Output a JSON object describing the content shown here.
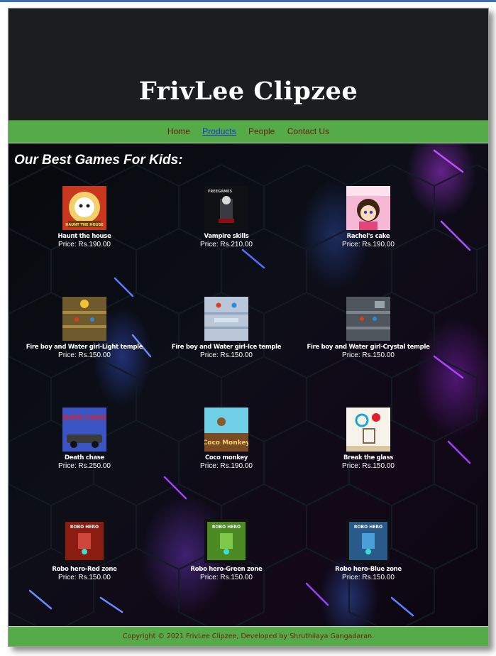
{
  "site": {
    "title": "FrivLee Clipzee"
  },
  "nav": {
    "items": [
      {
        "label": "Home"
      },
      {
        "label": "Products"
      },
      {
        "label": "People"
      },
      {
        "label": "Contact Us"
      }
    ],
    "active": "Products"
  },
  "section": {
    "title": "Our Best Games For Kids:"
  },
  "games": [
    {
      "name": "Haunt the house",
      "price": "Price: Rs.190.00"
    },
    {
      "name": "Vampire skills",
      "price": "Price: Rs.210.00"
    },
    {
      "name": "Rachel's cake",
      "price": "Price: Rs.190.00"
    },
    {
      "name": "Fire boy and Water girl-Light temple",
      "price": "Price: Rs.150.00"
    },
    {
      "name": "Fire boy and Water girl-Ice temple",
      "price": "Price: Rs.150.00"
    },
    {
      "name": "Fire boy and Water girl-Crystal temple",
      "price": "Price: Rs.150.00"
    },
    {
      "name": "Death chase",
      "price": "Price: Rs.250.00"
    },
    {
      "name": "Coco monkey",
      "price": "Price: Rs.190.00"
    },
    {
      "name": "Break the glass",
      "price": "Price: Rs.150.00"
    },
    {
      "name": "Robo hero-Red zone",
      "price": "Price: Rs.150.00"
    },
    {
      "name": "Robo hero-Green zone",
      "price": "Price: Rs.150.00"
    },
    {
      "name": "Robo hero-Blue zone",
      "price": "Price: Rs.150.00"
    }
  ],
  "thumb_text": {
    "haunt": "HAUNT THE HOUSE",
    "vampire": "FREEGAMES",
    "death": "DEATH CHASE",
    "coco": "Coco Monkey",
    "robo": "ROBO HERO"
  },
  "footer": {
    "text": "Copyright © 2021 FrivLee Clipzee, Developed by Shruthilaya Gangadaran."
  },
  "colors": {
    "header_bg": "#1b1d1f",
    "nav_bg": "#54ab47",
    "nav_link": "#6b1d10",
    "nav_active": "#1a3ad6",
    "footer_text": "#6b1d10"
  }
}
